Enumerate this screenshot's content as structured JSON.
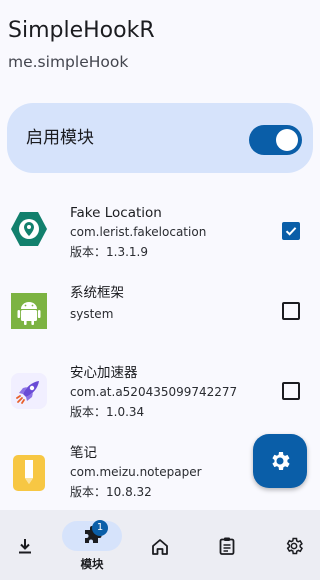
{
  "header": {
    "title": "SimpleHookR",
    "subtitle": "me.simpleHook"
  },
  "enable_card": {
    "label": "启用模块",
    "enabled": true
  },
  "modules": [
    {
      "name": "Fake Location",
      "package": "com.lerist.fakelocation",
      "version": "版本：1.3.1.9",
      "checked": true,
      "icon": "fake-location-app-icon"
    },
    {
      "name": "系统框架",
      "package": "system",
      "version": "",
      "checked": false,
      "icon": "android-app-icon"
    },
    {
      "name": "安心加速器",
      "package": "com.at.a520435099742277",
      "version": "版本：1.0.34",
      "checked": false,
      "icon": "rocket-app-icon"
    },
    {
      "name": "笔记",
      "package": "com.meizu.notepaper",
      "version": "版本：10.8.32",
      "checked": false,
      "icon": "notes-app-icon"
    }
  ],
  "fab": {
    "icon": "gear-icon"
  },
  "bottom_nav": {
    "items": [
      {
        "icon": "download-icon",
        "label": ""
      },
      {
        "icon": "puzzle-icon",
        "label": "模块",
        "badge": "1",
        "selected": true
      },
      {
        "icon": "home-icon",
        "label": ""
      },
      {
        "icon": "clipboard-icon",
        "label": ""
      },
      {
        "icon": "settings-icon",
        "label": ""
      }
    ]
  },
  "colors": {
    "background": "#f9f9fe",
    "card": "#d6e3fb",
    "accent": "#0a5ea8",
    "nav_bar": "#ecedf3"
  }
}
